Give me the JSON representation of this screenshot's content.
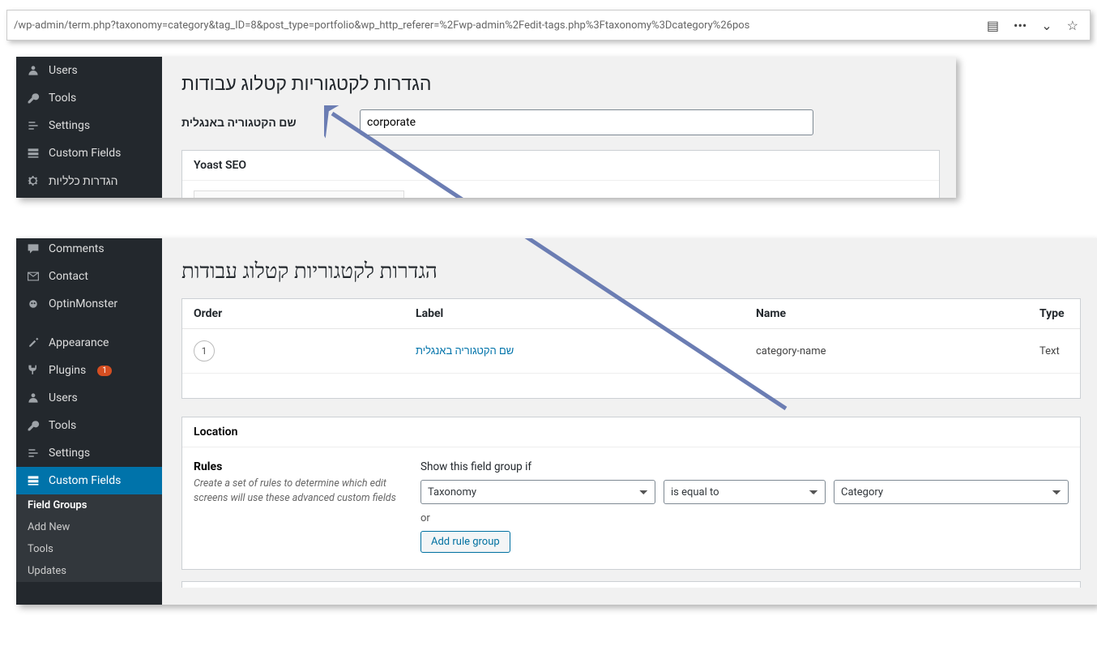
{
  "url": "/wp-admin/term.php?taxonomy=category&tag_ID=8&post_type=portfolio&wp_http_referer=%2Fwp-admin%2Fedit-tags.php%3Ftaxonomy%3Dcategory%26pos",
  "top": {
    "sidebar": {
      "users": "Users",
      "tools": "Tools",
      "settings": "Settings",
      "custom_fields": "Custom Fields",
      "general_settings": "הגדרות כלליות"
    },
    "title": "הגדרות לקטגוריות קטלוג עבודות",
    "field_label": "שם הקטגוריה באנגלית",
    "field_value": "corporate",
    "yoast": "Yoast SEO"
  },
  "bottom": {
    "sidebar": {
      "comments": "Comments",
      "contact": "Contact",
      "optinmonster": "OptinMonster",
      "appearance": "Appearance",
      "plugins": "Plugins",
      "plugins_badge": "1",
      "users": "Users",
      "tools": "Tools",
      "settings": "Settings",
      "custom_fields": "Custom Fields",
      "sub_field_groups": "Field Groups",
      "sub_add_new": "Add New",
      "sub_tools": "Tools",
      "sub_updates": "Updates"
    },
    "title": "הגדרות לקטגוריות קטלוג עבודות",
    "table": {
      "headers": {
        "order": "Order",
        "label": "Label",
        "name": "Name",
        "type": "Type"
      },
      "row": {
        "order": "1",
        "label": "שם הקטגוריה באנגלית",
        "name": "category-name",
        "type": "Text"
      }
    },
    "location": {
      "title": "Location",
      "rules_title": "Rules",
      "rules_desc": "Create a set of rules to determine which edit screens will use these advanced custom fields",
      "show_label": "Show this field group if",
      "select_taxonomy": "Taxonomy",
      "select_equal": "is equal to",
      "select_category": "Category",
      "or": "or",
      "add_rule": "Add rule group"
    }
  }
}
